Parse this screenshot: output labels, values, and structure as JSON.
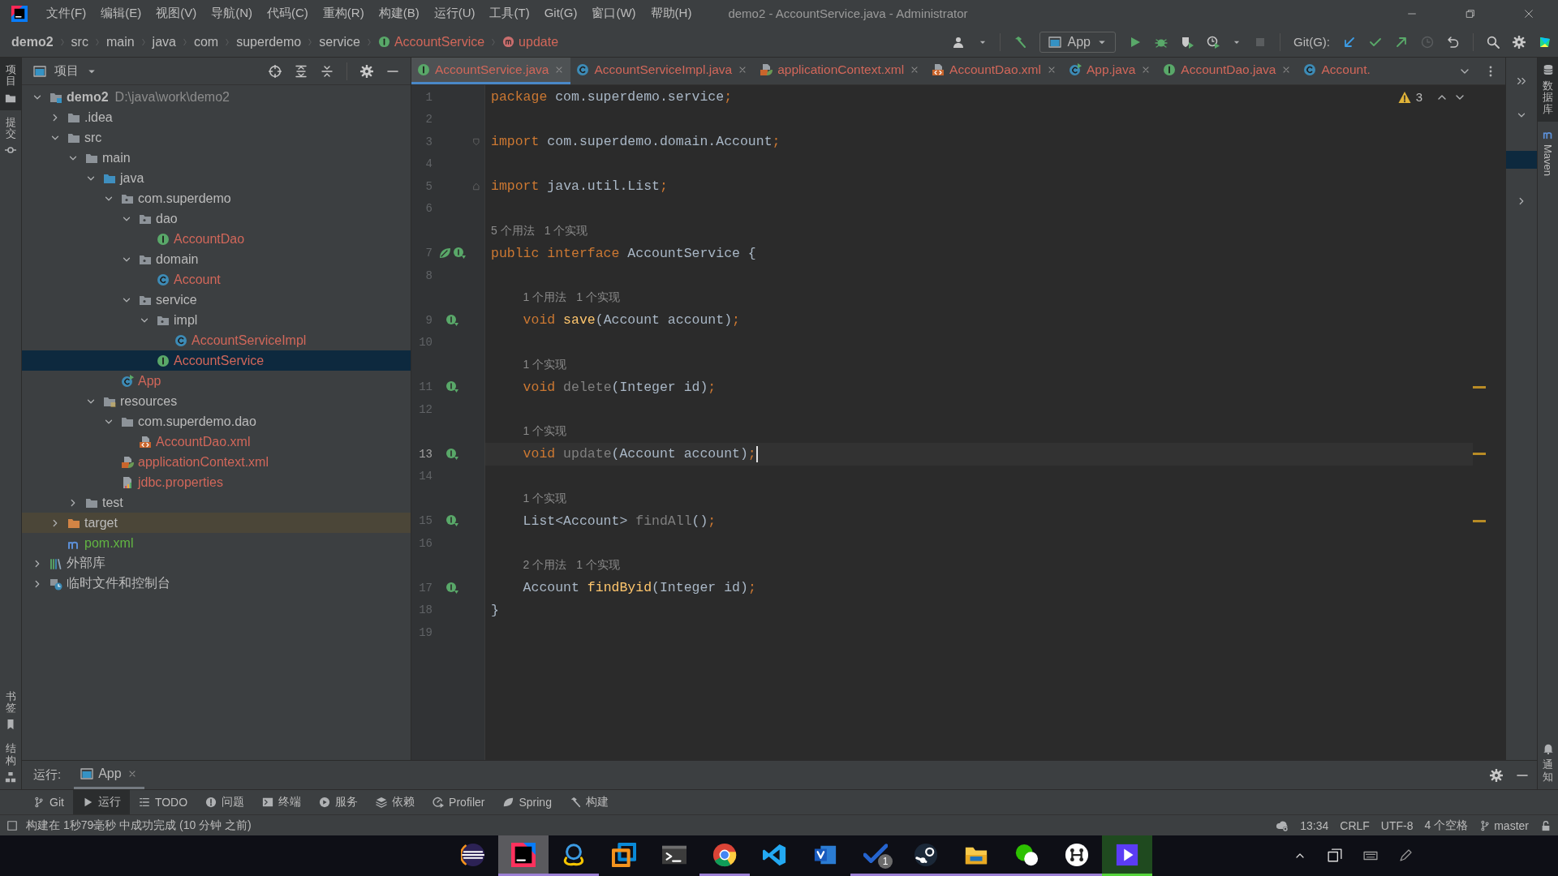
{
  "window": {
    "title": "demo2 - AccountService.java - Administrator"
  },
  "menu": [
    "文件(F)",
    "编辑(E)",
    "视图(V)",
    "导航(N)",
    "代码(C)",
    "重构(R)",
    "构建(B)",
    "运行(U)",
    "工具(T)",
    "Git(G)",
    "窗口(W)",
    "帮助(H)"
  ],
  "breadcrumbs": [
    {
      "label": "demo2",
      "kind": "project"
    },
    {
      "label": "src",
      "kind": "dir"
    },
    {
      "label": "main",
      "kind": "dir"
    },
    {
      "label": "java",
      "kind": "dir"
    },
    {
      "label": "com",
      "kind": "dir"
    },
    {
      "label": "superdemo",
      "kind": "dir"
    },
    {
      "label": "service",
      "kind": "dir"
    },
    {
      "label": "AccountService",
      "kind": "interface"
    },
    {
      "label": "update",
      "kind": "method"
    }
  ],
  "toolbar": {
    "run_config": "App",
    "git_label": "Git(G):"
  },
  "left_strip": {
    "top": [
      {
        "label": "项目",
        "kind": "project",
        "selected": true
      },
      {
        "label": "提交",
        "kind": "commit",
        "selected": false
      }
    ],
    "bottom": [
      {
        "label": "书签",
        "kind": "bookmarks",
        "selected": false
      },
      {
        "label": "结构",
        "kind": "structure",
        "selected": false
      }
    ]
  },
  "project_panel": {
    "title": "项目",
    "tree": [
      {
        "label": "demo2",
        "path": "D:\\java\\work\\demo2",
        "kind": "module",
        "expanded": true,
        "selected": false,
        "children": [
          {
            "label": ".idea",
            "kind": "folder",
            "expanded": false,
            "selected": false
          },
          {
            "label": "src",
            "kind": "folder",
            "expanded": true,
            "selected": false,
            "children": [
              {
                "label": "main",
                "kind": "folder",
                "expanded": true,
                "selected": false,
                "children": [
                  {
                    "label": "java",
                    "kind": "source",
                    "expanded": true,
                    "selected": false,
                    "children": [
                      {
                        "label": "com.superdemo",
                        "kind": "package",
                        "expanded": true,
                        "selected": false,
                        "children": [
                          {
                            "label": "dao",
                            "kind": "package",
                            "expanded": true,
                            "selected": false,
                            "children": [
                              {
                                "label": "AccountDao",
                                "kind": "interface",
                                "color": "#d1675a",
                                "selected": false
                              }
                            ]
                          },
                          {
                            "label": "domain",
                            "kind": "package",
                            "expanded": true,
                            "selected": false,
                            "children": [
                              {
                                "label": "Account",
                                "kind": "class",
                                "color": "#d1675a",
                                "selected": false
                              }
                            ]
                          },
                          {
                            "label": "service",
                            "kind": "package",
                            "expanded": true,
                            "selected": false,
                            "children": [
                              {
                                "label": "impl",
                                "kind": "package",
                                "expanded": true,
                                "selected": false,
                                "children": [
                                  {
                                    "label": "AccountServiceImpl",
                                    "kind": "class",
                                    "color": "#d1675a",
                                    "selected": false
                                  }
                                ]
                              },
                              {
                                "label": "AccountService",
                                "kind": "interface",
                                "color": "#d1675a",
                                "selected": true
                              }
                            ]
                          }
                        ]
                      },
                      {
                        "label": "App",
                        "kind": "app",
                        "color": "#d1675a",
                        "selected": false
                      }
                    ]
                  },
                  {
                    "label": "resources",
                    "kind": "resources",
                    "expanded": true,
                    "selected": false,
                    "children": [
                      {
                        "label": "com.superdemo.dao",
                        "kind": "folder",
                        "expanded": true,
                        "selected": false,
                        "children": [
                          {
                            "label": "AccountDao.xml",
                            "kind": "xml",
                            "color": "#d1675a",
                            "selected": false
                          }
                        ]
                      },
                      {
                        "label": "applicationContext.xml",
                        "kind": "spring-xml",
                        "color": "#d1675a",
                        "selected": false
                      },
                      {
                        "label": "jdbc.properties",
                        "kind": "properties",
                        "color": "#d1675a",
                        "selected": false
                      }
                    ]
                  }
                ]
              },
              {
                "label": "test",
                "kind": "folder",
                "expanded": false,
                "selected": false
              }
            ]
          },
          {
            "label": "target",
            "kind": "excluded",
            "expanded": false,
            "selected": false
          },
          {
            "label": "pom.xml",
            "kind": "maven",
            "color": "#62b543",
            "selected": false
          }
        ]
      },
      {
        "label": "外部库",
        "kind": "library",
        "expanded": false,
        "selected": false
      },
      {
        "label": "临时文件和控制台",
        "kind": "scratch",
        "expanded": false,
        "selected": false
      }
    ]
  },
  "tabs": [
    {
      "label": "AccountService.java",
      "kind": "interface",
      "selected": true
    },
    {
      "label": "AccountServiceImpl.java",
      "kind": "class",
      "selected": false
    },
    {
      "label": "applicationContext.xml",
      "kind": "spring-xml",
      "selected": false
    },
    {
      "label": "AccountDao.xml",
      "kind": "xml",
      "selected": false
    },
    {
      "label": "App.java",
      "kind": "app",
      "selected": false
    },
    {
      "label": "AccountDao.java",
      "kind": "interface",
      "selected": false
    },
    {
      "label": "Account.",
      "kind": "class",
      "selected": false
    }
  ],
  "editor": {
    "warning_count": "3",
    "lines": [
      {
        "kind": "code",
        "number": "1",
        "current": false,
        "warning": false,
        "tokens": [
          {
            "t": "package",
            "kind": "keyword"
          },
          {
            "t": " com.superdemo.service",
            "kind": "plain"
          },
          {
            "t": ";",
            "kind": "keyword"
          }
        ]
      },
      {
        "kind": "code",
        "number": "2",
        "current": false,
        "warning": false
      },
      {
        "kind": "code",
        "number": "3",
        "current": false,
        "warning": false,
        "fold": {
          "kind": "start"
        },
        "tokens": [
          {
            "t": "import",
            "kind": "keyword"
          },
          {
            "t": " com.superdemo.domain.Account",
            "kind": "plain"
          },
          {
            "t": ";",
            "kind": "keyword"
          }
        ]
      },
      {
        "kind": "code",
        "number": "4",
        "current": false,
        "warning": false
      },
      {
        "kind": "code",
        "number": "5",
        "current": false,
        "warning": false,
        "fold": {
          "kind": "end"
        },
        "tokens": [
          {
            "t": "import",
            "kind": "keyword"
          },
          {
            "t": " java.util.List",
            "kind": "plain"
          },
          {
            "t": ";",
            "kind": "keyword"
          }
        ]
      },
      {
        "kind": "code",
        "number": "6",
        "current": false,
        "warning": false
      },
      {
        "kind": "hint",
        "hints": [
          "5 个用法",
          "1 个实现"
        ]
      },
      {
        "kind": "code",
        "number": "7",
        "current": false,
        "warning": false,
        "gutter": [
          {
            "kind": "bean"
          },
          {
            "kind": "implemented"
          }
        ],
        "tokens": [
          {
            "t": "public interface",
            "kind": "keyword"
          },
          {
            "t": " AccountService {",
            "kind": "plain"
          }
        ]
      },
      {
        "kind": "code",
        "number": "8",
        "current": false,
        "warning": false
      },
      {
        "kind": "hint",
        "hints": [
          "1 个用法",
          "1 个实现"
        ]
      },
      {
        "kind": "code",
        "number": "9",
        "current": false,
        "warning": false,
        "gutter": [
          {
            "kind": "implemented"
          }
        ],
        "tokens": [
          {
            "t": "    void",
            "kind": "keyword"
          },
          {
            "t": " save",
            "kind": "method"
          },
          {
            "t": "(Account account)",
            "kind": "plain"
          },
          {
            "t": ";",
            "kind": "keyword"
          }
        ]
      },
      {
        "kind": "code",
        "number": "10",
        "current": false,
        "warning": false
      },
      {
        "kind": "hint",
        "hints": [
          "1 个实现"
        ]
      },
      {
        "kind": "code",
        "number": "11",
        "current": false,
        "warning": true,
        "gutter": [
          {
            "kind": "implemented"
          }
        ],
        "tokens": [
          {
            "t": "    void",
            "kind": "keyword"
          },
          {
            "t": " delete",
            "kind": "unused"
          },
          {
            "t": "(Integer id)",
            "kind": "plain"
          },
          {
            "t": ";",
            "kind": "keyword"
          }
        ]
      },
      {
        "kind": "code",
        "number": "12",
        "current": false,
        "warning": false
      },
      {
        "kind": "hint",
        "hints": [
          "1 个实现"
        ]
      },
      {
        "kind": "code",
        "number": "13",
        "current": true,
        "warning": true,
        "gutter": [
          {
            "kind": "implemented"
          }
        ],
        "tokens": [
          {
            "t": "    void",
            "kind": "keyword"
          },
          {
            "t": " update",
            "kind": "unused"
          },
          {
            "t": "(Account account)",
            "kind": "plain"
          },
          {
            "t": ";",
            "kind": "keyword"
          }
        ]
      },
      {
        "kind": "code",
        "number": "14",
        "current": false,
        "warning": false
      },
      {
        "kind": "hint",
        "hints": [
          "1 个实现"
        ]
      },
      {
        "kind": "code",
        "number": "15",
        "current": false,
        "warning": true,
        "gutter": [
          {
            "kind": "implemented"
          }
        ],
        "tokens": [
          {
            "t": "    List<Account> ",
            "kind": "plain"
          },
          {
            "t": "findAll",
            "kind": "unused"
          },
          {
            "t": "()",
            "kind": "plain"
          },
          {
            "t": ";",
            "kind": "keyword"
          }
        ]
      },
      {
        "kind": "code",
        "number": "16",
        "current": false,
        "warning": false
      },
      {
        "kind": "hint",
        "hints": [
          "2 个用法",
          "1 个实现"
        ]
      },
      {
        "kind": "code",
        "number": "17",
        "current": false,
        "warning": false,
        "gutter": [
          {
            "kind": "implemented"
          }
        ],
        "tokens": [
          {
            "t": "    Account ",
            "kind": "plain"
          },
          {
            "t": "findByid",
            "kind": "method"
          },
          {
            "t": "(Integer id)",
            "kind": "plain"
          },
          {
            "t": ";",
            "kind": "keyword"
          }
        ]
      },
      {
        "kind": "code",
        "number": "18",
        "current": false,
        "warning": false,
        "tokens": [
          {
            "t": "}",
            "kind": "plain"
          }
        ]
      },
      {
        "kind": "code",
        "number": "19",
        "current": false,
        "warning": false
      }
    ]
  },
  "right_strip": {
    "top": [
      {
        "label": "数据库",
        "kind": "database",
        "selected": true
      },
      {
        "label": "Maven",
        "kind": "maven",
        "selected": false
      }
    ],
    "bottom": [
      {
        "label": "通知",
        "kind": "notifications",
        "selected": false
      }
    ]
  },
  "run_panel": {
    "label": "运行:",
    "tabs": [
      {
        "label": "App",
        "selected": true
      }
    ]
  },
  "tool_windows": [
    {
      "label": "Git",
      "kind": "git",
      "selected": false
    },
    {
      "label": "运行",
      "kind": "run",
      "selected": true
    },
    {
      "label": "TODO",
      "kind": "todo",
      "selected": false
    },
    {
      "label": "问题",
      "kind": "problems",
      "selected": false
    },
    {
      "label": "终端",
      "kind": "terminal",
      "selected": false
    },
    {
      "label": "服务",
      "kind": "services",
      "selected": false
    },
    {
      "label": "依赖",
      "kind": "dependencies",
      "selected": false
    },
    {
      "label": "Profiler",
      "kind": "profiler",
      "selected": false
    },
    {
      "label": "Spring",
      "kind": "spring",
      "selected": false
    },
    {
      "label": "构建",
      "kind": "build",
      "selected": false
    }
  ],
  "status_bar": {
    "message": "构建在 1秒79毫秒 中成功完成 (10 分钟 之前)",
    "position": "13:34",
    "line_separator": "CRLF",
    "encoding": "UTF-8",
    "indent": "4 个空格",
    "branch": "master"
  },
  "taskbar": {
    "apps": [
      {
        "kind": "sphere",
        "running": false,
        "selected": false,
        "flashing": false
      },
      {
        "kind": "ide",
        "running": true,
        "selected": true,
        "flashing": false
      },
      {
        "kind": "rings",
        "running": true,
        "selected": false,
        "flashing": false
      },
      {
        "kind": "squares",
        "running": false,
        "selected": false,
        "flashing": false
      },
      {
        "kind": "terminal",
        "running": false,
        "selected": false,
        "flashing": false
      },
      {
        "kind": "browser",
        "running": true,
        "selected": false,
        "flashing": false
      },
      {
        "kind": "editor",
        "running": false,
        "selected": false,
        "flashing": false
      },
      {
        "kind": "diagram",
        "running": false,
        "selected": false,
        "flashing": false
      },
      {
        "kind": "tasks",
        "running": true,
        "selected": false,
        "flashing": false,
        "badge": "1"
      },
      {
        "kind": "games",
        "running": true,
        "selected": false,
        "flashing": false
      },
      {
        "kind": "files",
        "running": true,
        "selected": false,
        "flashing": false
      },
      {
        "kind": "chat",
        "running": true,
        "selected": false,
        "flashing": false
      },
      {
        "kind": "dots",
        "running": true,
        "selected": false,
        "flashing": false
      },
      {
        "kind": "player",
        "running": true,
        "selected": false,
        "flashing": true
      }
    ]
  }
}
